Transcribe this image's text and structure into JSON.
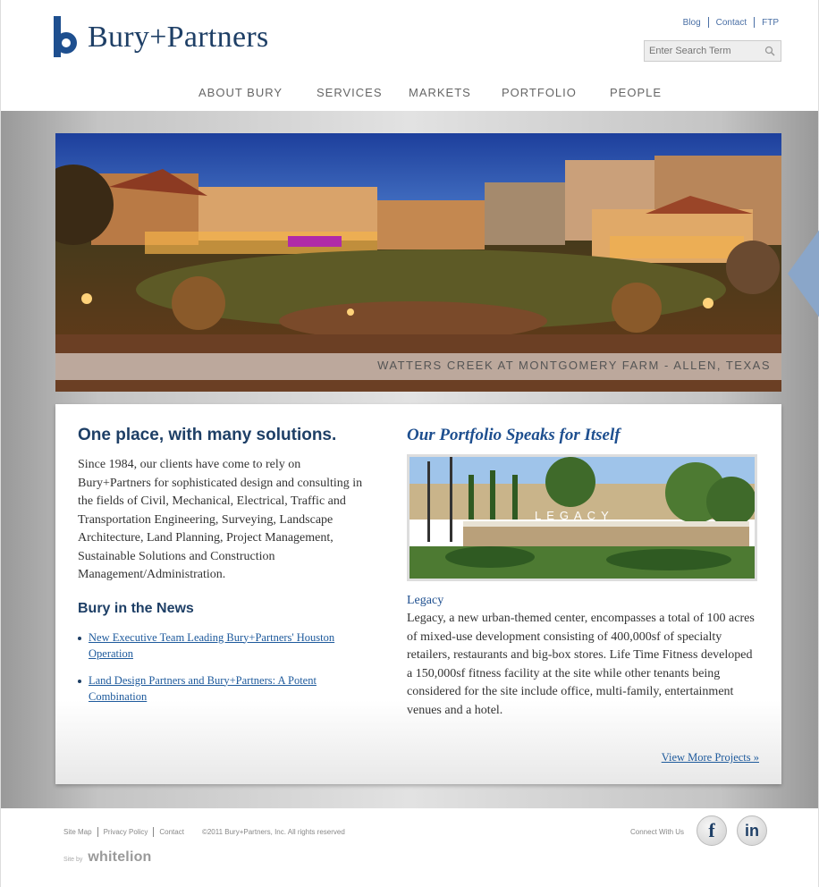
{
  "brand": {
    "name": "Bury+Partners"
  },
  "utility_links": [
    "Blog",
    "Contact",
    "FTP"
  ],
  "search": {
    "placeholder": "Enter Search Term"
  },
  "nav": [
    "ABOUT BURY",
    "SERVICES",
    "MARKETS",
    "PORTFOLIO",
    "PEOPLE"
  ],
  "hero": {
    "caption": "WATTERS CREEK AT MONTGOMERY FARM - ALLEN, TEXAS"
  },
  "left": {
    "heading": "One place, with many solutions.",
    "intro": "Since 1984, our clients have come to rely on Bury+Partners for sophisticated design and consulting in the fields of Civil, Mechanical, Electrical, Traffic and Transportation Engineering, Surveying, Landscape Architecture, Land Planning, Project Management, Sustainable Solutions and Construction Management/Administration.",
    "news_heading": "Bury in the News",
    "news": [
      "New Executive Team Leading Bury+Partners' Houston Operation",
      "Land Design Partners and Bury+Partners: A Potent Combination"
    ]
  },
  "right": {
    "heading": "Our Portfolio Speaks for Itself",
    "project_name": "Legacy",
    "project_desc": "Legacy, a new urban-themed center, encompasses a total of 100 acres of mixed-use development consisting of 400,000sf of specialty retailers, restaurants and big-box stores. Life Time Fitness developed a 150,000sf fitness facility at the site while other tenants being considered for the site include office, multi-family, entertainment venues and a hotel.",
    "view_more": "View More Projects »",
    "sign_text": "LEGACY"
  },
  "footer": {
    "links": [
      "Site Map",
      "Privacy Policy",
      "Contact"
    ],
    "copyright": "©2011 Bury+Partners, Inc. All rights reserved",
    "site_by_label": "Site by",
    "site_by_brand": "whitelion",
    "connect": "Connect With Us",
    "social": [
      "f",
      "in"
    ]
  },
  "colors": {
    "brand_blue": "#1e3f66",
    "link_blue": "#1e5a9c",
    "nav_grey": "#666666"
  },
  "icons": [
    "logo-mark-icon",
    "search-icon",
    "facebook-icon",
    "linkedin-icon",
    "carousel-next-arrow-icon"
  ]
}
